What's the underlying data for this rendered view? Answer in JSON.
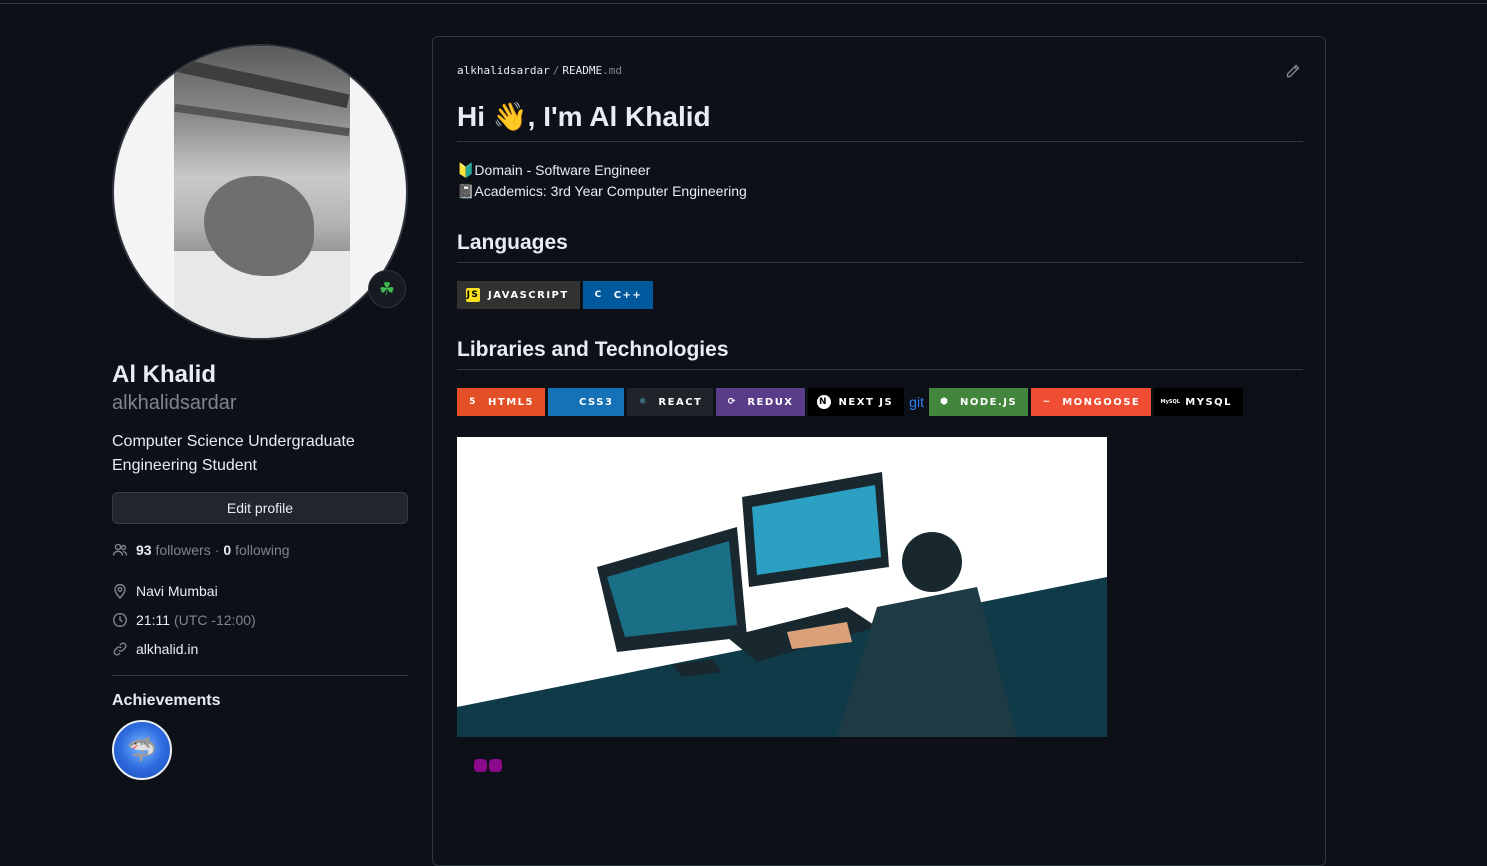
{
  "profile": {
    "name": "Al Khalid",
    "login": "alkhalidsardar",
    "bio_line1": "Computer Science Undergraduate",
    "bio_line2": "Engineering Student",
    "edit_label": "Edit profile",
    "followers_count": "93",
    "followers_label": "followers",
    "dot": "·",
    "following_count": "0",
    "following_label": "following",
    "location": "Navi Mumbai",
    "time": "21:11",
    "timezone": "(UTC -12:00)",
    "website": "alkhalid.in",
    "status_emoji": "☘",
    "achievements_title": "Achievements",
    "achievement_badge": "YOLO"
  },
  "readme": {
    "crumb_user": "alkhalidsardar",
    "crumb_sep": "/",
    "crumb_file": "README",
    "crumb_ext": ".md",
    "title": "Hi 👋, I'm Al Khalid",
    "line1": "🔰Domain - Software Engineer",
    "line2": "📓Academics: 3rd Year Computer Engineering",
    "languages_heading": "Languages",
    "languages": [
      {
        "label": "JAVASCRIPT",
        "bg": "#323330",
        "logo": "JS",
        "logo_bg": "#f7df1e",
        "logo_fg": "#000000"
      },
      {
        "label": "C++",
        "bg": "#00599c",
        "logo": "C",
        "logo_bg": "#00599c",
        "logo_fg": "#ffffff"
      }
    ],
    "libs_heading": "Libraries and Technologies",
    "libs": [
      {
        "label": "HTML5",
        "bg": "#e34f26",
        "logo": "5",
        "logo_bg": "#e34f26",
        "logo_fg": "#ffffff"
      },
      {
        "label": "CSS3",
        "bg": "#1572b6",
        "logo": "",
        "logo_bg": "#1572b6",
        "logo_fg": "#ffffff"
      },
      {
        "label": "REACT",
        "bg": "#20232a",
        "logo": "⚛",
        "logo_bg": "#20232a",
        "logo_fg": "#61dafb"
      },
      {
        "label": "REDUX",
        "bg": "#593d88",
        "logo": "⟳",
        "logo_bg": "#593d88",
        "logo_fg": "#ffffff"
      },
      {
        "label": "NEXT JS",
        "bg": "#000000",
        "logo": "N",
        "logo_bg": "#ffffff",
        "logo_fg": "#000000"
      },
      {
        "label": "NODE.JS",
        "bg": "#43853d",
        "logo": "⬢",
        "logo_bg": "#43853d",
        "logo_fg": "#ffffff"
      },
      {
        "label": "MONGOOSE",
        "bg": "#f04d35",
        "logo": "~",
        "logo_bg": "#f04d35",
        "logo_fg": "#ffffff"
      },
      {
        "label": "MYSQL",
        "bg": "#000000",
        "logo": "MySQL",
        "logo_bg": "#000000",
        "logo_fg": "#ffffff"
      }
    ],
    "git_text": "git"
  },
  "colors": {
    "background": "#0d1117",
    "border": "#30363d",
    "muted": "#7d8590",
    "link": "#2f81f7"
  }
}
